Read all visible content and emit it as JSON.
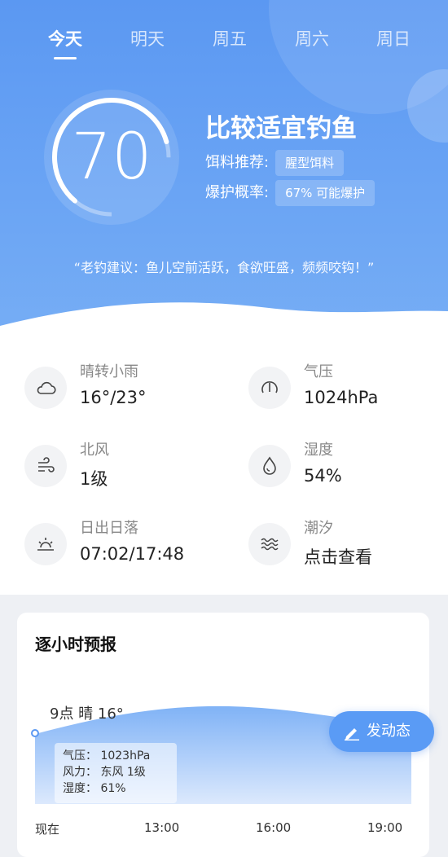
{
  "tabs": [
    "今天",
    "明天",
    "周五",
    "周六",
    "周日"
  ],
  "score": {
    "value": "70",
    "fraction": 0.7
  },
  "fishing": {
    "title": "比较适宜钓鱼",
    "bait_label": "饵料推荐:",
    "bait_value": "腥型饵料",
    "rate_label": "爆护概率:",
    "rate_value": "67% 可能爆护"
  },
  "tip": "“老钓建议：鱼儿空前活跃，食欲旺盛，频频咬钩！”",
  "weather": {
    "condition": {
      "icon": "cloud-icon",
      "label": "晴转小雨",
      "value": "16°/23°"
    },
    "pressure": {
      "icon": "pressure-gauge-icon",
      "label": "气压",
      "value": "1024hPa"
    },
    "wind": {
      "icon": "wind-icon",
      "label": "北风",
      "value": "1级"
    },
    "humidity": {
      "icon": "droplet-icon",
      "label": "湿度",
      "value": "54%"
    },
    "sun": {
      "icon": "sunrise-icon",
      "label": "日出日落",
      "value": "07:02/17:48"
    },
    "tide": {
      "icon": "waves-icon",
      "label": "潮汐",
      "value": "点击查看"
    }
  },
  "hourly": {
    "title": "逐小时预报",
    "point_label": "9点 晴 16°",
    "tooltip": {
      "pressure": "气压： 1023hPa",
      "wind": "风力： 东风 1级",
      "humidity": "湿度： 61%"
    },
    "x_labels": [
      "现在",
      "13:00",
      "16:00",
      "19:00"
    ]
  },
  "fab": {
    "label": "发动态",
    "icon": "pen-icon"
  },
  "colors": {
    "primary": "#5b98f2",
    "hero_bottom": "#77aef5",
    "fab": "#5a9bf5"
  }
}
